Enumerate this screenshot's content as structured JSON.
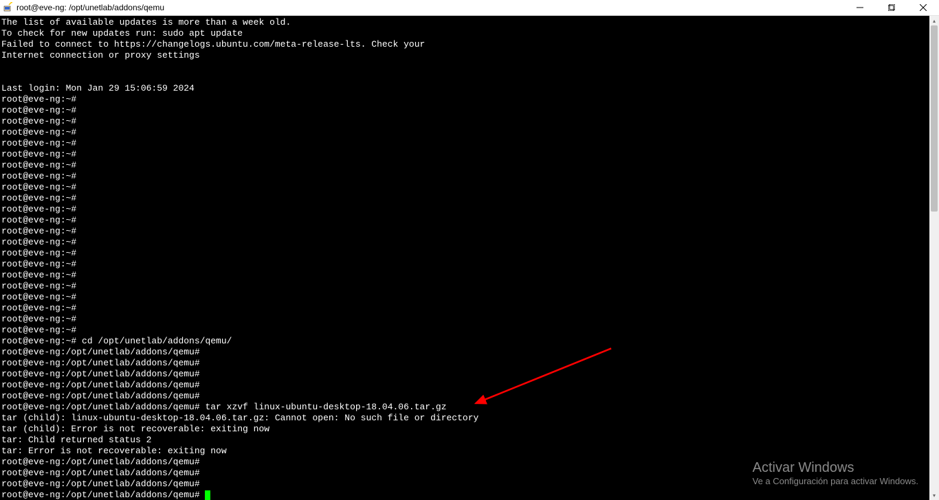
{
  "window": {
    "title": "root@eve-ng: /opt/unetlab/addons/qemu"
  },
  "terminal": {
    "lines": [
      "The list of available updates is more than a week old.",
      "To check for new updates run: sudo apt update",
      "Failed to connect to https://changelogs.ubuntu.com/meta-release-lts. Check your",
      "Internet connection or proxy settings",
      "",
      "",
      "Last login: Mon Jan 29 15:06:59 2024",
      "root@eve-ng:~#",
      "root@eve-ng:~#",
      "root@eve-ng:~#",
      "root@eve-ng:~#",
      "root@eve-ng:~#",
      "root@eve-ng:~#",
      "root@eve-ng:~#",
      "root@eve-ng:~#",
      "root@eve-ng:~#",
      "root@eve-ng:~#",
      "root@eve-ng:~#",
      "root@eve-ng:~#",
      "root@eve-ng:~#",
      "root@eve-ng:~#",
      "root@eve-ng:~#",
      "root@eve-ng:~#",
      "root@eve-ng:~#",
      "root@eve-ng:~#",
      "root@eve-ng:~#",
      "root@eve-ng:~#",
      "root@eve-ng:~#",
      "root@eve-ng:~#",
      "root@eve-ng:~# cd /opt/unetlab/addons/qemu/",
      "root@eve-ng:/opt/unetlab/addons/qemu#",
      "root@eve-ng:/opt/unetlab/addons/qemu#",
      "root@eve-ng:/opt/unetlab/addons/qemu#",
      "root@eve-ng:/opt/unetlab/addons/qemu#",
      "root@eve-ng:/opt/unetlab/addons/qemu#",
      "root@eve-ng:/opt/unetlab/addons/qemu# tar xzvf linux-ubuntu-desktop-18.04.06.tar.gz",
      "tar (child): linux-ubuntu-desktop-18.04.06.tar.gz: Cannot open: No such file or directory",
      "tar (child): Error is not recoverable: exiting now",
      "tar: Child returned status 2",
      "tar: Error is not recoverable: exiting now",
      "root@eve-ng:/opt/unetlab/addons/qemu#",
      "root@eve-ng:/opt/unetlab/addons/qemu#",
      "root@eve-ng:/opt/unetlab/addons/qemu#",
      "root@eve-ng:/opt/unetlab/addons/qemu# "
    ],
    "cursor_on_last": true
  },
  "annotation": {
    "arrow_color": "#ff0000"
  },
  "watermark": {
    "title": "Activar Windows",
    "subtitle": "Ve a Configuración para activar Windows."
  }
}
